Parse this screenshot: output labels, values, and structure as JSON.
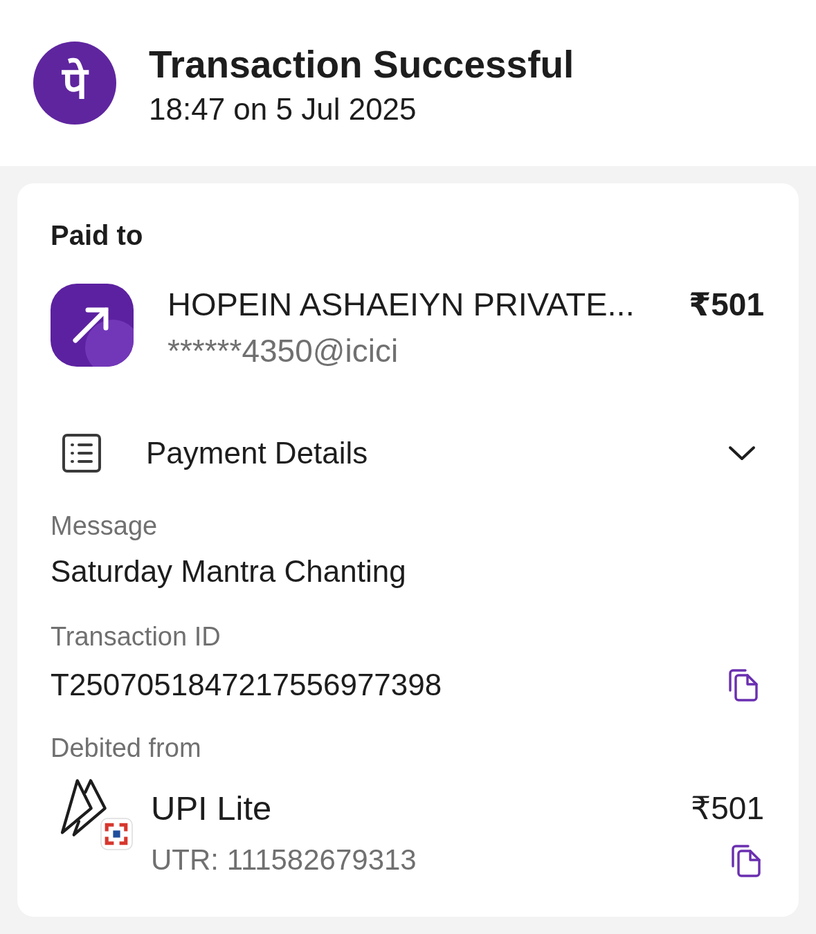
{
  "header": {
    "logo": "पे",
    "title": "Transaction Successful",
    "timestamp": "18:47 on 5 Jul 2025"
  },
  "paid_to": {
    "heading": "Paid to",
    "name": "HOPEIN ASHAEIYN PRIVATE...",
    "amount": "₹501",
    "vpa": "******4350@icici"
  },
  "payment_details": {
    "title": "Payment Details",
    "expanded": true,
    "fields": [
      {
        "label": "Message",
        "value": "Saturday Mantra Chanting",
        "copyable": false
      },
      {
        "label": "Transaction ID",
        "value": "T2507051847217556977398",
        "copyable": true
      }
    ]
  },
  "debited_from": {
    "label": "Debited from",
    "account": "UPI Lite",
    "amount": "₹501",
    "utr": "UTR: 111582679313",
    "copyable": true
  }
}
